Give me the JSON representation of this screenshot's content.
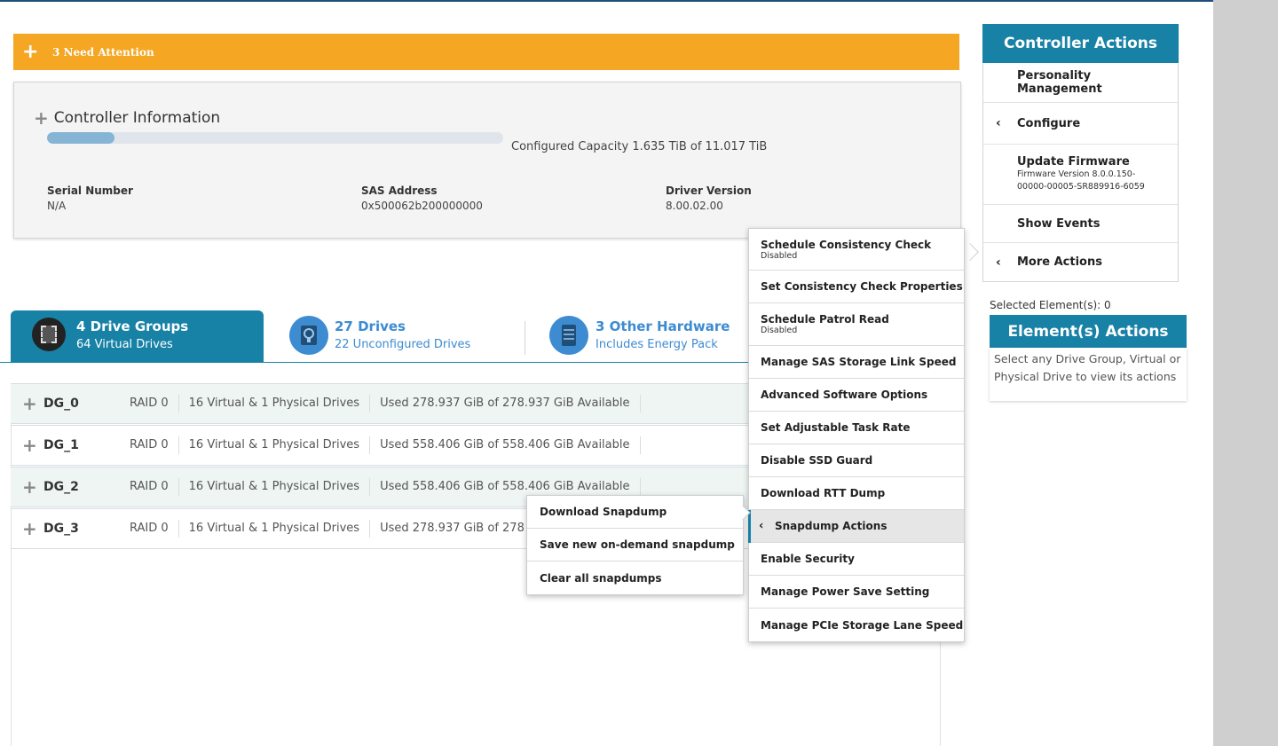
{
  "attention": {
    "icon": "plus-icon",
    "label": "3 Need Attention",
    "color": "#f5a623"
  },
  "controller": {
    "title": "Controller Information",
    "capacity_fraction": 0.148,
    "capacity_text": "Configured Capacity 1.635 TiB of 11.017 TiB",
    "fields": [
      {
        "label": "Serial Number",
        "value": "N/A"
      },
      {
        "label": "SAS Address",
        "value": "0x500062b200000000"
      },
      {
        "label": "Driver Version",
        "value": "8.00.02.00"
      }
    ]
  },
  "tabs": [
    {
      "title": "4 Drive Groups",
      "subtitle": "64 Virtual Drives",
      "active": true
    },
    {
      "title": "27 Drives",
      "subtitle": "22 Unconfigured Drives",
      "active": false
    },
    {
      "title": "3 Other Hardware",
      "subtitle": "Includes Energy Pack",
      "active": false
    }
  ],
  "drive_groups": [
    {
      "name": "DG_0",
      "raid": "RAID 0",
      "drives": "16 Virtual & 1 Physical Drives",
      "usage": "Used 278.937 GiB of 278.937 GiB Available"
    },
    {
      "name": "DG_1",
      "raid": "RAID 0",
      "drives": "16 Virtual & 1 Physical Drives",
      "usage": "Used 558.406 GiB of 558.406 GiB Available"
    },
    {
      "name": "DG_2",
      "raid": "RAID 0",
      "drives": "16 Virtual & 1 Physical Drives",
      "usage": "Used 558.406 GiB of 558.406 GiB Available"
    },
    {
      "name": "DG_3",
      "raid": "RAID 0",
      "drives": "16 Virtual & 1 Physical Drives",
      "usage": "Used 278.937 GiB of 278"
    }
  ],
  "controller_actions": {
    "header": "Controller Actions",
    "items": [
      {
        "label": "Personality Management"
      },
      {
        "label": "Configure"
      },
      {
        "label": "Update Firmware",
        "sub1": "Firmware Version 8.0.0.150-",
        "sub2": "00000-00005-SR889916-6059"
      },
      {
        "label": "Show Events"
      },
      {
        "label": "More Actions"
      }
    ]
  },
  "selected_elements": "Selected Element(s): 0",
  "element_actions": {
    "header": "Element(s) Actions",
    "hint": "Select any Drive Group, Virtual or Physical Drive to view its actions"
  },
  "more_actions_menu": [
    {
      "label": "Schedule Consistency Check",
      "sub": "Disabled"
    },
    {
      "label": "Set Consistency Check Properties"
    },
    {
      "label": "Schedule Patrol Read",
      "sub": "Disabled"
    },
    {
      "label": "Manage SAS Storage Link Speed"
    },
    {
      "label": "Advanced Software Options"
    },
    {
      "label": "Set Adjustable Task Rate"
    },
    {
      "label": "Disable SSD Guard"
    },
    {
      "label": "Download RTT Dump"
    },
    {
      "label": "Snapdump Actions"
    },
    {
      "label": "Enable Security"
    },
    {
      "label": "Manage Power Save Setting"
    },
    {
      "label": "Manage PCIe Storage Lane Speed"
    }
  ],
  "snapdump_menu": [
    {
      "label": "Download Snapdump"
    },
    {
      "label": "Save new on-demand snapdump"
    },
    {
      "label": "Clear all snapdumps"
    }
  ]
}
